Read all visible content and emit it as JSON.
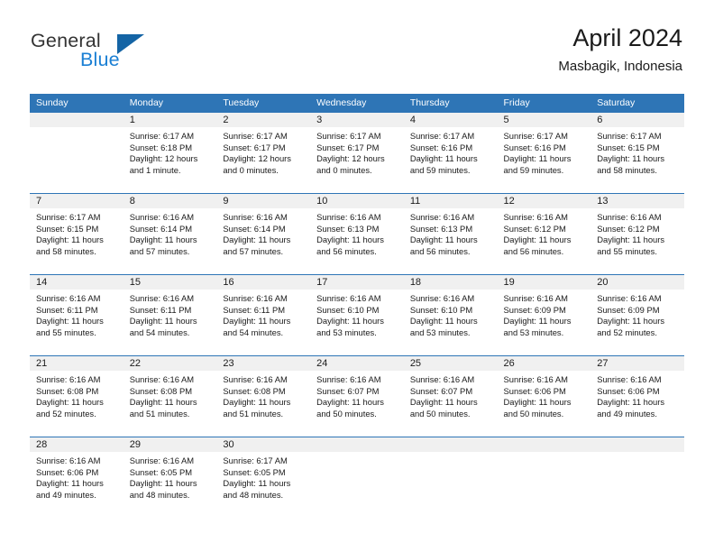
{
  "brand": {
    "name_top": "General",
    "name_bottom": "Blue",
    "flag_icon": "triangle-flag-icon",
    "accent_color": "#1a7fd4",
    "flag_color": "#1464a5"
  },
  "header": {
    "title": "April 2024",
    "subtitle": "Masbagik, Indonesia"
  },
  "theme": {
    "header_row_bg": "#2e75b6",
    "header_row_text": "#ffffff",
    "daynum_band_bg": "#f0f0f0",
    "week_separator": "#2e75b6"
  },
  "weekday_headers": [
    "Sunday",
    "Monday",
    "Tuesday",
    "Wednesday",
    "Thursday",
    "Friday",
    "Saturday"
  ],
  "weeks": [
    [
      {
        "day": "",
        "details": ""
      },
      {
        "day": "1",
        "details": "Sunrise: 6:17 AM\nSunset: 6:18 PM\nDaylight: 12 hours\nand 1 minute."
      },
      {
        "day": "2",
        "details": "Sunrise: 6:17 AM\nSunset: 6:17 PM\nDaylight: 12 hours\nand 0 minutes."
      },
      {
        "day": "3",
        "details": "Sunrise: 6:17 AM\nSunset: 6:17 PM\nDaylight: 12 hours\nand 0 minutes."
      },
      {
        "day": "4",
        "details": "Sunrise: 6:17 AM\nSunset: 6:16 PM\nDaylight: 11 hours\nand 59 minutes."
      },
      {
        "day": "5",
        "details": "Sunrise: 6:17 AM\nSunset: 6:16 PM\nDaylight: 11 hours\nand 59 minutes."
      },
      {
        "day": "6",
        "details": "Sunrise: 6:17 AM\nSunset: 6:15 PM\nDaylight: 11 hours\nand 58 minutes."
      }
    ],
    [
      {
        "day": "7",
        "details": "Sunrise: 6:17 AM\nSunset: 6:15 PM\nDaylight: 11 hours\nand 58 minutes."
      },
      {
        "day": "8",
        "details": "Sunrise: 6:16 AM\nSunset: 6:14 PM\nDaylight: 11 hours\nand 57 minutes."
      },
      {
        "day": "9",
        "details": "Sunrise: 6:16 AM\nSunset: 6:14 PM\nDaylight: 11 hours\nand 57 minutes."
      },
      {
        "day": "10",
        "details": "Sunrise: 6:16 AM\nSunset: 6:13 PM\nDaylight: 11 hours\nand 56 minutes."
      },
      {
        "day": "11",
        "details": "Sunrise: 6:16 AM\nSunset: 6:13 PM\nDaylight: 11 hours\nand 56 minutes."
      },
      {
        "day": "12",
        "details": "Sunrise: 6:16 AM\nSunset: 6:12 PM\nDaylight: 11 hours\nand 56 minutes."
      },
      {
        "day": "13",
        "details": "Sunrise: 6:16 AM\nSunset: 6:12 PM\nDaylight: 11 hours\nand 55 minutes."
      }
    ],
    [
      {
        "day": "14",
        "details": "Sunrise: 6:16 AM\nSunset: 6:11 PM\nDaylight: 11 hours\nand 55 minutes."
      },
      {
        "day": "15",
        "details": "Sunrise: 6:16 AM\nSunset: 6:11 PM\nDaylight: 11 hours\nand 54 minutes."
      },
      {
        "day": "16",
        "details": "Sunrise: 6:16 AM\nSunset: 6:11 PM\nDaylight: 11 hours\nand 54 minutes."
      },
      {
        "day": "17",
        "details": "Sunrise: 6:16 AM\nSunset: 6:10 PM\nDaylight: 11 hours\nand 53 minutes."
      },
      {
        "day": "18",
        "details": "Sunrise: 6:16 AM\nSunset: 6:10 PM\nDaylight: 11 hours\nand 53 minutes."
      },
      {
        "day": "19",
        "details": "Sunrise: 6:16 AM\nSunset: 6:09 PM\nDaylight: 11 hours\nand 53 minutes."
      },
      {
        "day": "20",
        "details": "Sunrise: 6:16 AM\nSunset: 6:09 PM\nDaylight: 11 hours\nand 52 minutes."
      }
    ],
    [
      {
        "day": "21",
        "details": "Sunrise: 6:16 AM\nSunset: 6:08 PM\nDaylight: 11 hours\nand 52 minutes."
      },
      {
        "day": "22",
        "details": "Sunrise: 6:16 AM\nSunset: 6:08 PM\nDaylight: 11 hours\nand 51 minutes."
      },
      {
        "day": "23",
        "details": "Sunrise: 6:16 AM\nSunset: 6:08 PM\nDaylight: 11 hours\nand 51 minutes."
      },
      {
        "day": "24",
        "details": "Sunrise: 6:16 AM\nSunset: 6:07 PM\nDaylight: 11 hours\nand 50 minutes."
      },
      {
        "day": "25",
        "details": "Sunrise: 6:16 AM\nSunset: 6:07 PM\nDaylight: 11 hours\nand 50 minutes."
      },
      {
        "day": "26",
        "details": "Sunrise: 6:16 AM\nSunset: 6:06 PM\nDaylight: 11 hours\nand 50 minutes."
      },
      {
        "day": "27",
        "details": "Sunrise: 6:16 AM\nSunset: 6:06 PM\nDaylight: 11 hours\nand 49 minutes."
      }
    ],
    [
      {
        "day": "28",
        "details": "Sunrise: 6:16 AM\nSunset: 6:06 PM\nDaylight: 11 hours\nand 49 minutes."
      },
      {
        "day": "29",
        "details": "Sunrise: 6:16 AM\nSunset: 6:05 PM\nDaylight: 11 hours\nand 48 minutes."
      },
      {
        "day": "30",
        "details": "Sunrise: 6:17 AM\nSunset: 6:05 PM\nDaylight: 11 hours\nand 48 minutes."
      },
      {
        "day": "",
        "details": ""
      },
      {
        "day": "",
        "details": ""
      },
      {
        "day": "",
        "details": ""
      },
      {
        "day": "",
        "details": ""
      }
    ]
  ]
}
